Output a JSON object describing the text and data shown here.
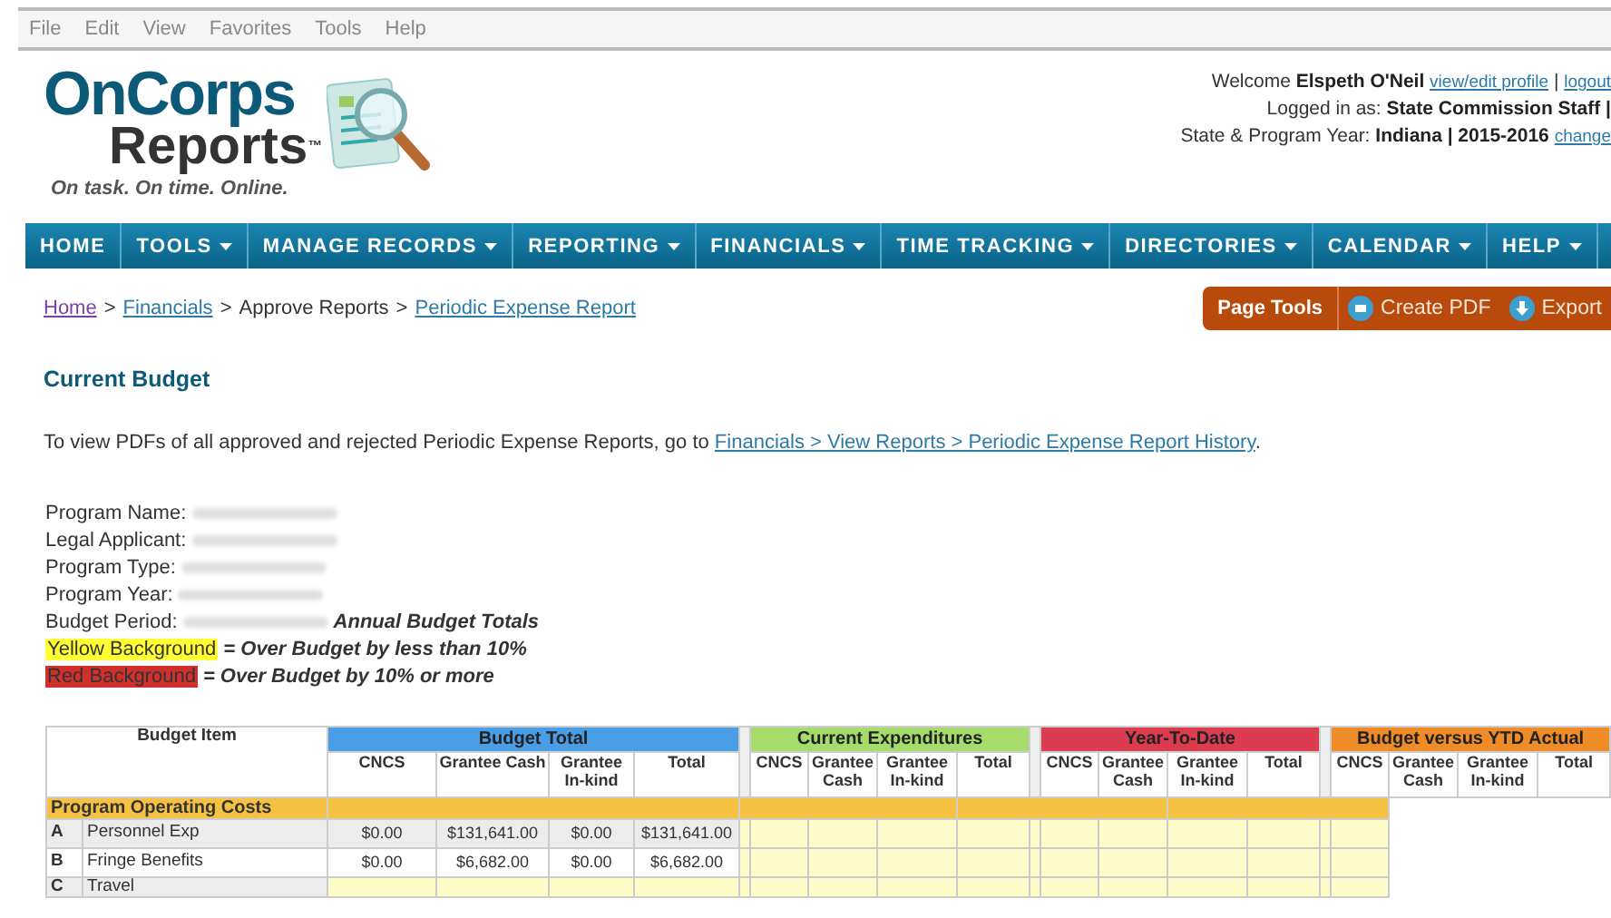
{
  "menu_bar": [
    "File",
    "Edit",
    "View",
    "Favorites",
    "Tools",
    "Help"
  ],
  "logo": {
    "line1": "OnCorps",
    "line2": "Reports",
    "mark": "™",
    "tagline": "On task. On time. Online."
  },
  "user_info": {
    "welcome": "Welcome",
    "name": "Elspeth O'Neil",
    "profile_link": "view/edit profile",
    "logout_link": "logout",
    "separator": "|",
    "logged_in_label": "Logged in as:",
    "role": "State Commission Staff |",
    "year_label": "State & Program Year:",
    "year_value": "Indiana | 2015-2016",
    "change_link": "change"
  },
  "nav": [
    {
      "label": "HOME",
      "dropdown": false
    },
    {
      "label": "TOOLS",
      "dropdown": true
    },
    {
      "label": "MANAGE RECORDS",
      "dropdown": true
    },
    {
      "label": "REPORTING",
      "dropdown": true
    },
    {
      "label": "FINANCIALS",
      "dropdown": true
    },
    {
      "label": "TIME TRACKING",
      "dropdown": true
    },
    {
      "label": "DIRECTORIES",
      "dropdown": true
    },
    {
      "label": "CALENDAR",
      "dropdown": true
    },
    {
      "label": "HELP",
      "dropdown": true
    }
  ],
  "breadcrumb": {
    "separator": ">",
    "items": [
      {
        "label": "Home",
        "link": true
      },
      {
        "label": "Financials",
        "link": true
      },
      {
        "label": "Approve Reports",
        "link": false
      },
      {
        "label": "Periodic Expense Report",
        "link": true
      }
    ]
  },
  "page_tools": {
    "label": "Page Tools",
    "actions": [
      {
        "label": "Create PDF",
        "kind": "print"
      },
      {
        "label": "Export",
        "kind": "export"
      }
    ]
  },
  "title": "Current Budget",
  "info": {
    "text": "To view PDFs of all approved and rejected Periodic Expense Reports, go to",
    "link": "Financials > View Reports > Periodic Expense Report History",
    "end": "."
  },
  "details": [
    {
      "label": "Program Name:",
      "redacted": true
    },
    {
      "label": "Legal Applicant:",
      "redacted": true
    },
    {
      "label": "Program Type:",
      "redacted": true
    },
    {
      "label": "Program Year:",
      "redacted": true
    },
    {
      "label": "Budget Period:",
      "redacted": true,
      "value": "Annual Budget Totals"
    }
  ],
  "legend": [
    {
      "label": "Yellow Background",
      "color": "#ffff33",
      "text": "= Over Budget by less than 10%"
    },
    {
      "label": "Red Background",
      "color": "#d0302c",
      "text": "= Over Budget by 10% or more"
    }
  ],
  "table": {
    "item_header": "Budget Item",
    "groups": [
      {
        "title": "Budget Total",
        "color": "#4a9ee6",
        "columns": [
          "CNCS",
          "Grantee Cash",
          "Grantee In-kind",
          "Total"
        ]
      },
      {
        "title": "Current Expenditures",
        "color": "#a6dc6c",
        "columns": [
          "CNCS",
          "Grantee Cash",
          "Grantee In-kind",
          "Total"
        ]
      },
      {
        "title": "Year-To-Date",
        "color": "#dc3c50",
        "columns": [
          "CNCS",
          "Grantee Cash",
          "Grantee In-kind",
          "Total"
        ]
      },
      {
        "title": "Budget versus YTD Actual",
        "color": "#f08c28",
        "columns": [
          "CNCS",
          "Grantee Cash",
          "Grantee In-kind",
          "Total"
        ]
      }
    ],
    "section": "Program Operating Costs",
    "rows": [
      {
        "letter": "A",
        "item": "Personnel Exp",
        "values": [
          "$0.00",
          "$131,641.00",
          "$0.00",
          "$131,641.00"
        ]
      },
      {
        "letter": "B",
        "item": "Fringe Benefits",
        "values": [
          "$0.00",
          "$6,682.00",
          "$0.00",
          "$6,682.00"
        ]
      },
      {
        "letter": "C",
        "item": "Travel",
        "values": []
      }
    ]
  }
}
